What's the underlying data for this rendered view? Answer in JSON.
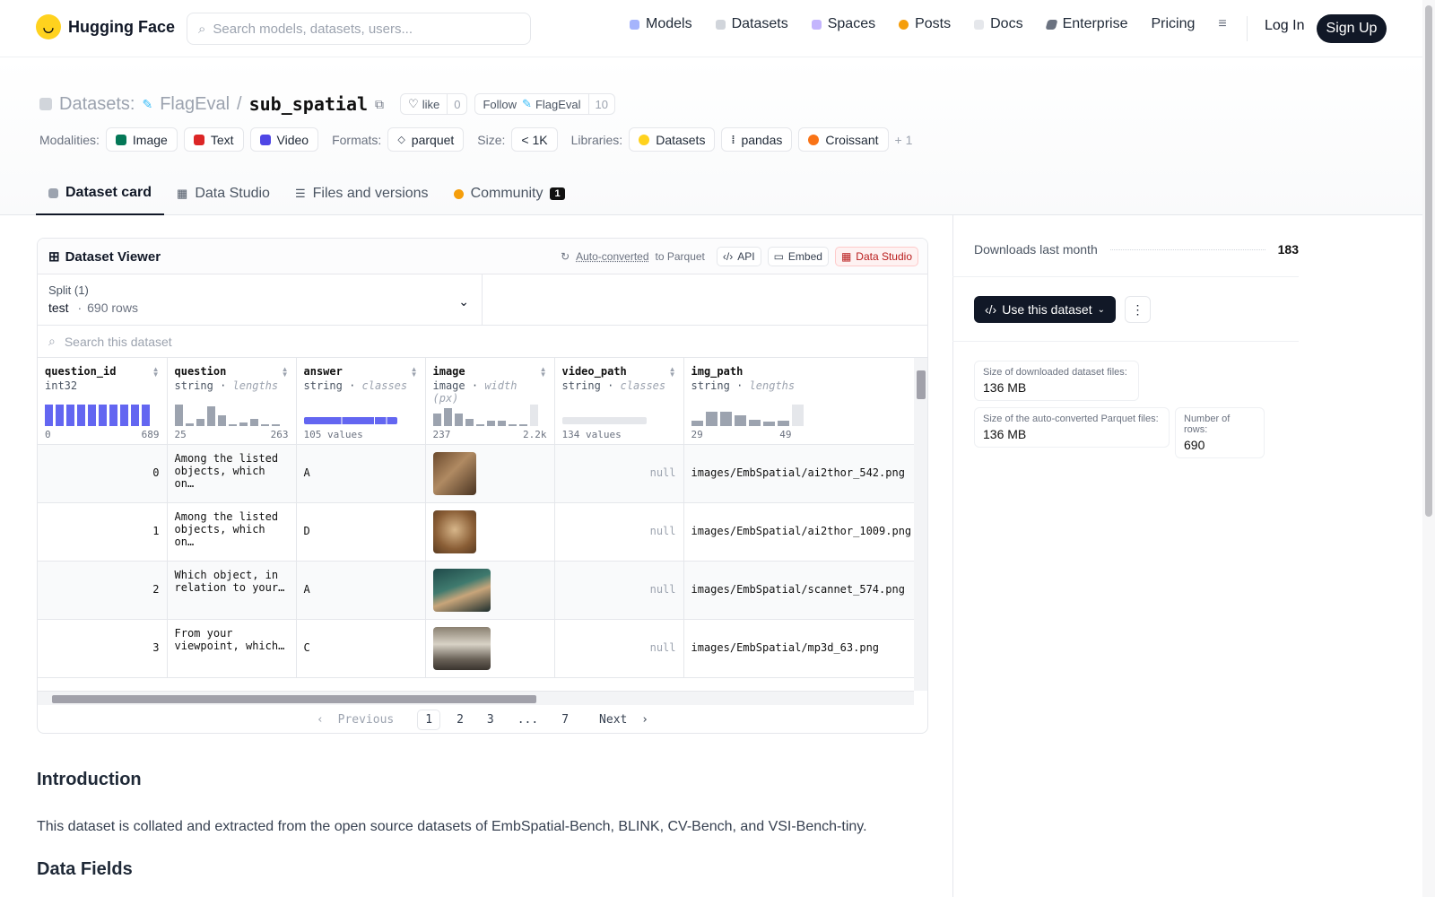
{
  "nav": {
    "brand": "Hugging Face",
    "search_placeholder": "Search models, datasets, users...",
    "links": [
      "Models",
      "Datasets",
      "Spaces",
      "Posts",
      "Docs",
      "Enterprise",
      "Pricing"
    ],
    "login": "Log In",
    "signup": "Sign Up"
  },
  "repo": {
    "section": "Datasets:",
    "owner": "FlagEval",
    "sep": "/",
    "name": "sub_spatial",
    "like_label": "like",
    "like_count": "0",
    "follow_label": "Follow",
    "follow_owner": "FlagEval",
    "follow_count": "10"
  },
  "meta": {
    "modalities_label": "Modalities:",
    "modalities": [
      "Image",
      "Text",
      "Video"
    ],
    "formats_label": "Formats:",
    "format": "parquet",
    "size_label": "Size:",
    "size": "< 1K",
    "libraries_label": "Libraries:",
    "libraries": [
      "Datasets",
      "pandas",
      "Croissant"
    ],
    "more": "+ 1"
  },
  "tabs": [
    "Dataset card",
    "Data Studio",
    "Files and versions",
    "Community"
  ],
  "community_count": "1",
  "viewer": {
    "title": "Dataset Viewer",
    "auto_converted": "Auto-converted",
    "to_parquet": "to Parquet",
    "api": "API",
    "embed": "Embed",
    "data_studio": "Data Studio",
    "split_label": "Split (1)",
    "split_name": "test",
    "split_rows": "690 rows",
    "search_placeholder": "Search this dataset",
    "columns": [
      {
        "name": "question_id",
        "type": "int32",
        "stat": "",
        "min": "0",
        "max": "689"
      },
      {
        "name": "question",
        "type": "string",
        "stat": "lengths",
        "min": "25",
        "max": "263"
      },
      {
        "name": "answer",
        "type": "string",
        "stat": "classes",
        "min": "105 values",
        "max": ""
      },
      {
        "name": "image",
        "type": "image",
        "stat": "width (px)",
        "min": "237",
        "max": "2.2k"
      },
      {
        "name": "video_path",
        "type": "string",
        "stat": "classes",
        "min": "134 values",
        "max": ""
      },
      {
        "name": "img_path",
        "type": "string",
        "stat": "lengths",
        "min": "29",
        "max": "49"
      }
    ],
    "rows": [
      {
        "id": "0",
        "question": "Among the listed objects, which on…",
        "answer": "A",
        "video": "null",
        "path": "images/EmbSpatial/ai2thor_542.png"
      },
      {
        "id": "1",
        "question": "Among the listed objects, which on…",
        "answer": "D",
        "video": "null",
        "path": "images/EmbSpatial/ai2thor_1009.png"
      },
      {
        "id": "2",
        "question": "Which object, in relation to your…",
        "answer": "A",
        "video": "null",
        "path": "images/EmbSpatial/scannet_574.png"
      },
      {
        "id": "3",
        "question": "From your viewpoint, which…",
        "answer": "C",
        "video": "null",
        "path": "images/EmbSpatial/mp3d_63.png"
      }
    ],
    "pager": {
      "prev": "Previous",
      "pages": [
        "1",
        "2",
        "3",
        "...",
        "7"
      ],
      "next": "Next"
    }
  },
  "card": {
    "intro_heading": "Introduction",
    "intro_text": "This dataset is collated and extracted from the open source datasets of EmbSpatial-Bench, BLINK, CV-Bench, and VSI-Bench-tiny.",
    "fields_heading": "Data Fields"
  },
  "sidebar": {
    "downloads_label": "Downloads last month",
    "downloads": "183",
    "use_button": "Use this dataset",
    "size_files_label": "Size of downloaded dataset files:",
    "size_files": "136 MB",
    "size_parquet_label": "Size of the auto-converted Parquet files:",
    "size_parquet": "136 MB",
    "rows_label": "Number of rows:",
    "rows": "690"
  },
  "colors": {
    "accent": "#6366f1",
    "dark": "#111827",
    "hf_yellow": "#ffd21e"
  }
}
